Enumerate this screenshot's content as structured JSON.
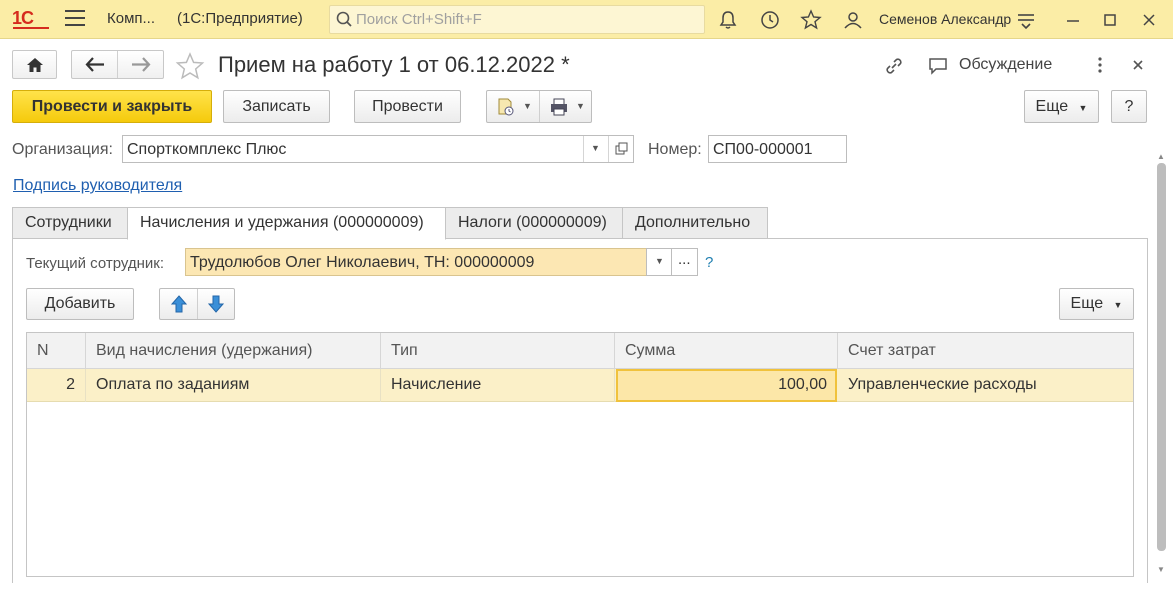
{
  "topbar": {
    "logo": "1С",
    "app_name": "Комп...",
    "app_subtitle": "(1С:Предприятие)",
    "search_placeholder": "Поиск Ctrl+Shift+F",
    "user": "Семенов Александр"
  },
  "header": {
    "title": "Прием на работу 1 от 06.12.2022 *",
    "discussion": "Обсуждение"
  },
  "toolbar": {
    "post_close": "Провести и закрыть",
    "save": "Записать",
    "post": "Провести",
    "more": "Еще",
    "help": "?"
  },
  "form": {
    "org_label": "Организация:",
    "org_value": "Спорткомплекс Плюс",
    "number_label": "Номер:",
    "number_value": "СП00-000001",
    "signature_link": "Подпись руководителя"
  },
  "tabs": [
    {
      "label": "Сотрудники"
    },
    {
      "label": "Начисления и удержания (000000009)"
    },
    {
      "label": "Налоги (000000009)"
    },
    {
      "label": "Дополнительно"
    }
  ],
  "panel": {
    "employee_label": "Текущий сотрудник:",
    "employee_value": "Трудолюбов Олег Николаевич, ТН: 000000009",
    "dots": "...",
    "help": "?",
    "add": "Добавить",
    "more": "Еще"
  },
  "table": {
    "columns": [
      "N",
      "Вид начисления (удержания)",
      "Тип",
      "Сумма",
      "Счет затрат"
    ],
    "rows": [
      {
        "n": "2",
        "kind": "Оплата по заданиям",
        "type": "Начисление",
        "sum": "100,00",
        "account": "Управленческие расходы"
      }
    ]
  },
  "colors": {
    "topbar_bg": "#fbeda6",
    "primary_button": "#f5ca0c",
    "selected_row": "#fbf0c8",
    "link": "#1f5fb0"
  }
}
